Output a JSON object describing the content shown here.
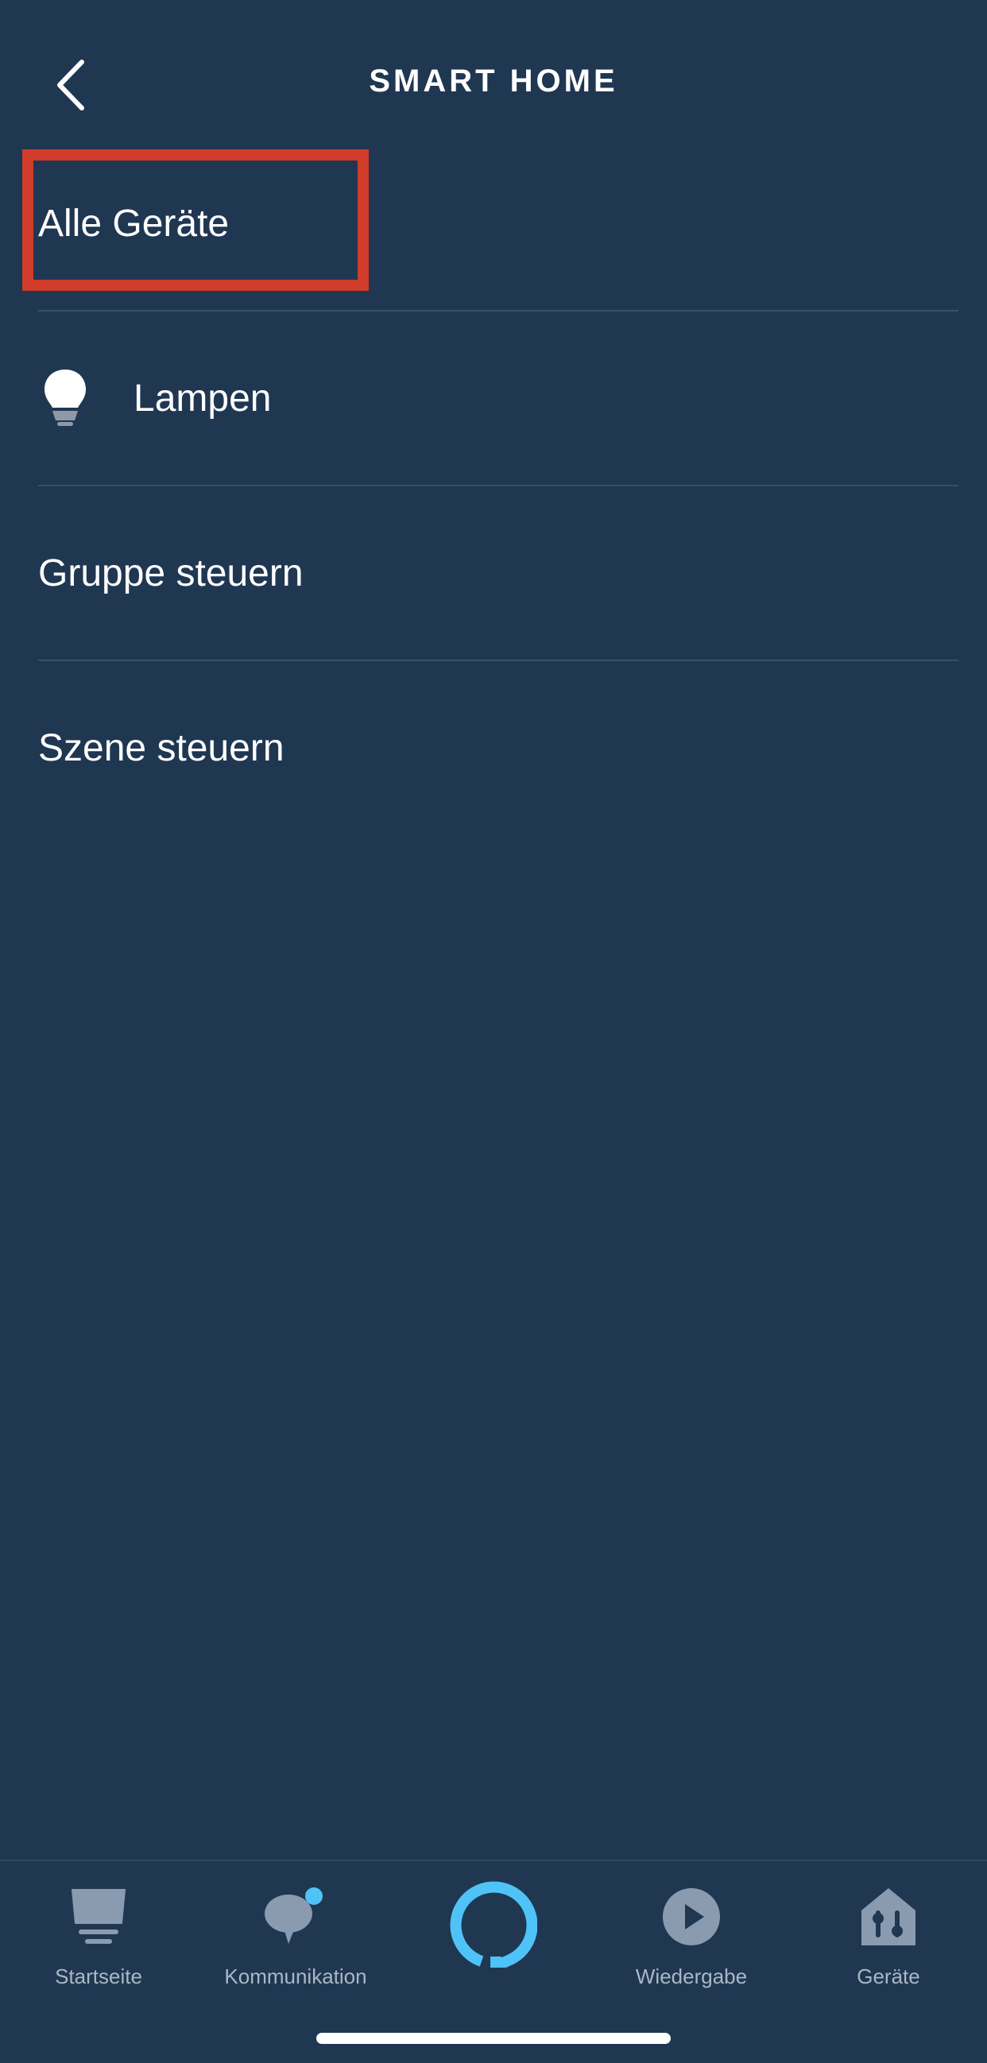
{
  "header": {
    "title": "SMART HOME",
    "back_icon": "chevron-left-icon"
  },
  "menu": {
    "items": [
      {
        "label": "Alle Geräte",
        "icon": null
      },
      {
        "label": "Lampen",
        "icon": "lightbulb-icon"
      },
      {
        "label": "Gruppe steuern",
        "icon": null
      },
      {
        "label": "Szene steuern",
        "icon": null
      }
    ]
  },
  "bottom_nav": {
    "items": [
      {
        "label": "Startseite",
        "icon": "home-icon"
      },
      {
        "label": "Kommunikation",
        "icon": "chat-bubble-icon"
      },
      {
        "label": "",
        "icon": "alexa-icon"
      },
      {
        "label": "Wiedergabe",
        "icon": "play-icon"
      },
      {
        "label": "Geräte",
        "icon": "devices-house-icon"
      }
    ]
  },
  "colors": {
    "background": "#203752",
    "divider": "#3a5068",
    "highlight": "#d13c2a",
    "alexa_accent": "#4fc3f7",
    "nav_label": "#a9b7c6",
    "nav_icon": "#8a9bb0"
  }
}
